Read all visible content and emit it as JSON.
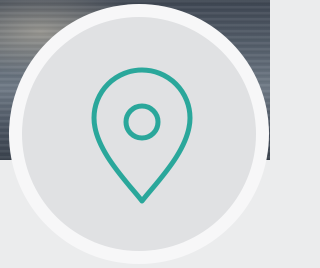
{
  "location_avatar": {
    "icon": "map-pin-icon",
    "icon_color": "#2aa79b",
    "circle_color": "#e0e1e3",
    "ring_color": "#f7f7f8",
    "page_background": "#ebeced"
  }
}
